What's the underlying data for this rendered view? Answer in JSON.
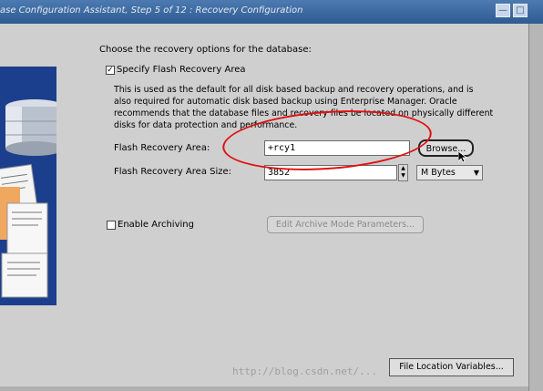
{
  "window": {
    "title": "ase Configuration Assistant, Step 5 of 12 : Recovery Configuration",
    "buttons": [
      "—",
      "□"
    ]
  },
  "main": {
    "intro": "Choose the recovery options for the database:",
    "flash_checkbox": {
      "label": "Specify Flash Recovery Area",
      "checked": "✓"
    },
    "description_lines": [
      "This is used as the default for all disk based backup and recovery operations, and is",
      "also required for automatic disk based backup using Enterprise Manager. Oracle",
      "recommends that the database files and recovery files be located on physically different",
      "disks for data protection and performance."
    ],
    "flash_area": {
      "label": "Flash Recovery Area:",
      "value": "+rcy1",
      "browse_label": "Browse..."
    },
    "flash_size": {
      "label": "Flash Recovery Area Size:",
      "value": "3852",
      "unit": "M Bytes"
    },
    "archiving": {
      "label": "Enable Archiving",
      "checked": "",
      "edit_button": "Edit Archive Mode Parameters..."
    },
    "file_location_button": "File Location Variables..."
  },
  "watermark": "http://blog.csdn.net/..."
}
